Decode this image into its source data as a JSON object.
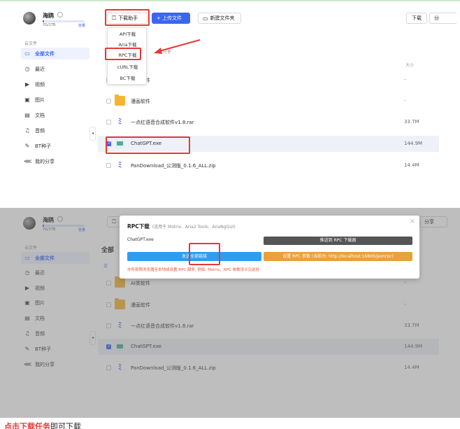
{
  "user": {
    "name": "海鸥",
    "quota": "7G/1TB",
    "upgrade": "容量",
    "quota_fraction": 0.007
  },
  "sidebar": {
    "section_label": "云文件",
    "items": [
      {
        "label": "全部文件",
        "icon": "folder-icon"
      },
      {
        "label": "最近",
        "icon": "clock-icon"
      },
      {
        "label": "视频",
        "icon": "video-icon"
      },
      {
        "label": "图片",
        "icon": "image-icon"
      },
      {
        "label": "文档",
        "icon": "document-icon"
      },
      {
        "label": "音频",
        "icon": "headphones-icon"
      },
      {
        "label": "BT种子",
        "icon": "magnet-icon"
      },
      {
        "label": "我的分享",
        "icon": "share-icon"
      }
    ]
  },
  "toolbar": {
    "download_helper": "下载助手",
    "upload": "+ 上传文件",
    "new_folder": "新建文件夹",
    "download": "下载",
    "share": "分享",
    "share_cut": "分"
  },
  "download_menu": [
    "API下载",
    "Aria下载",
    "RPC下载",
    "cURL下载",
    "BC下载"
  ],
  "partial_text": {
    "selected_count": "1: 分享",
    "breadcrumb_cut": "全部",
    "select_all_cut": "文"
  },
  "list": {
    "size_header": "大小",
    "files": [
      {
        "name": "AI类软件",
        "size": "-",
        "type": "folder"
      },
      {
        "name": "漫画软件",
        "size": "-",
        "type": "folder"
      },
      {
        "name": "一点红语音合成软件v1.8.rar",
        "size": "33.7M",
        "type": "rar"
      },
      {
        "name": "ChatGPT.exe",
        "size": "144.9M",
        "type": "exe"
      },
      {
        "name": "PanDownload_公测版_0.1.6_ALL.zip",
        "size": "14.4M",
        "type": "rar"
      }
    ]
  },
  "rpc_modal": {
    "title": "RPC下载",
    "subtitle": "(适用于 Motrix、Aria2 Tools、AriaNgGUI)",
    "file": "ChatGPT.exe",
    "send_button": "推送到 RPC 下载器",
    "copy_button": "发送全部链接",
    "settings_button": "设置 RPC 参数 (当前为: http://localhost:16800/jsonrpc)",
    "tip": "亦所按照浏览器至本地成设置 RPC 服务, 例如: Motrix、RPC 参数设义见此处",
    "close": "×"
  },
  "caption": {
    "text": "即可下载",
    "bold": "点击下载任务"
  }
}
